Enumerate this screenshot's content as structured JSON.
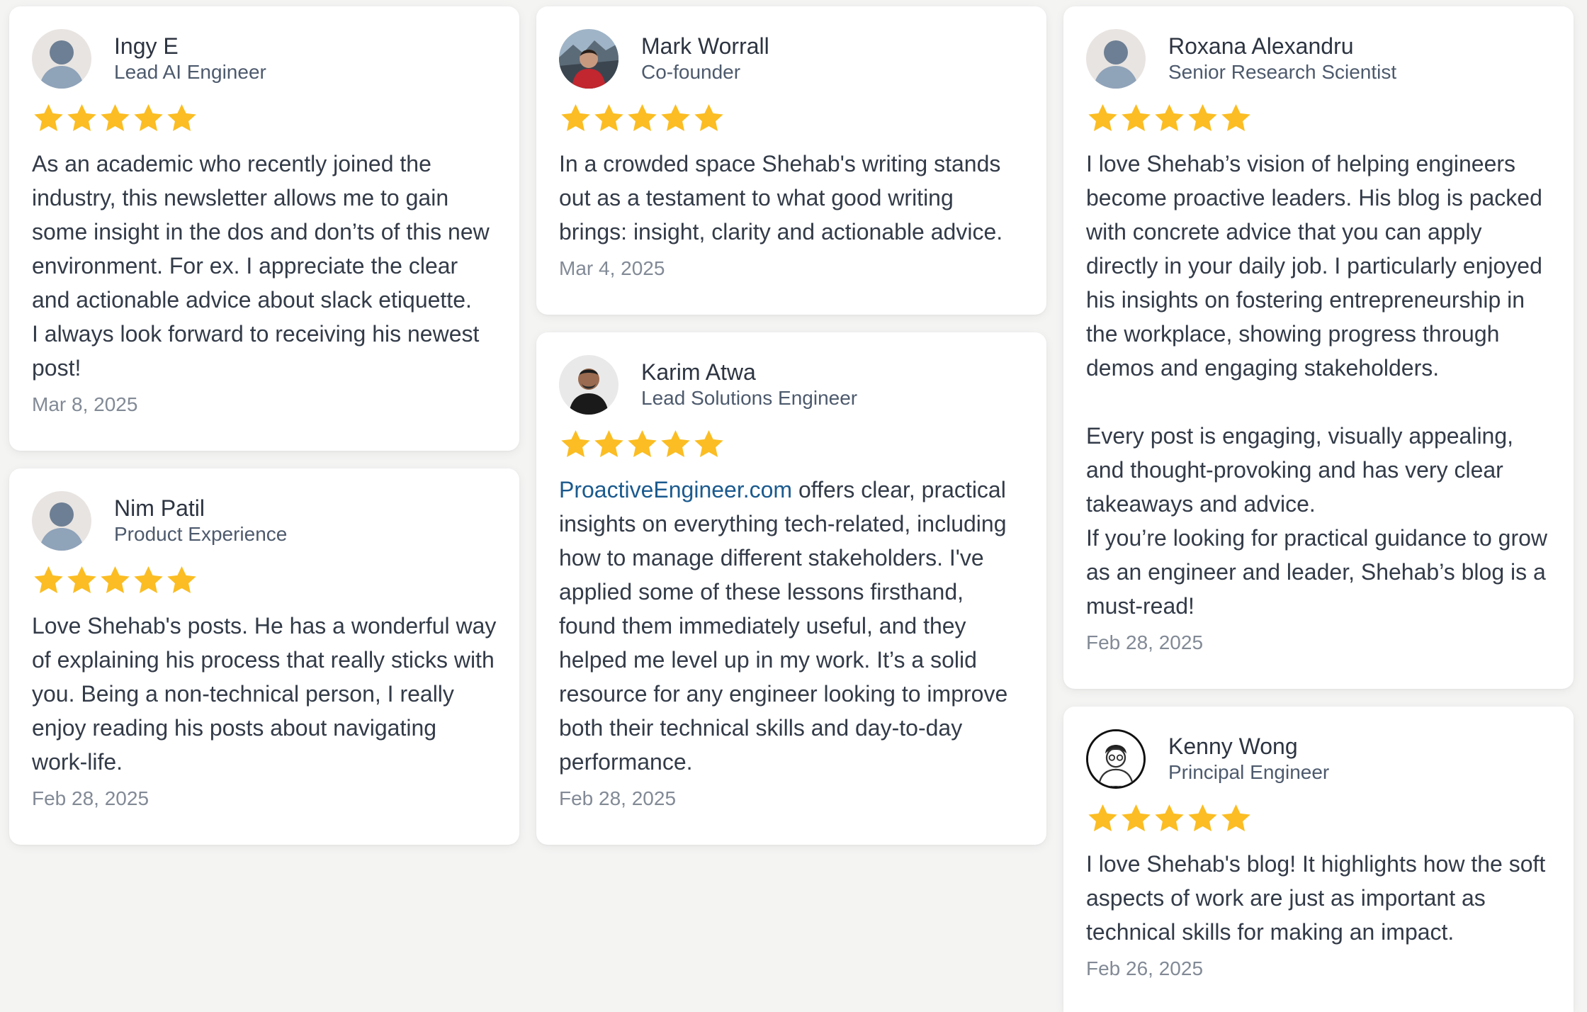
{
  "colors": {
    "star": "#FBBD23",
    "link": "#1B5A8E",
    "background": "#F4F4F3"
  },
  "rating_max": 5,
  "testimonials": [
    {
      "name": "Ingy E",
      "role": "Lead AI Engineer",
      "avatar": "default-avatar-icon",
      "rating": 5,
      "review": "As an academic who recently joined the industry, this newsletter allows me to gain some insight in the dos and don’ts of this new environment. For ex. I appreciate the clear and actionable advice about slack etiquette.\nI always look forward to receiving his newest post!",
      "date": "Mar 8, 2025"
    },
    {
      "name": "Nim Patil",
      "role": "Product Experience",
      "avatar": "default-avatar-icon",
      "rating": 5,
      "review": "Love Shehab's posts. He has a wonderful way of explaining his process that really sticks with you. Being a non-technical person, I really enjoy reading his posts about navigating work-life.",
      "date": "Feb 28, 2025"
    },
    {
      "name": "Mark Worrall",
      "role": "Co-founder",
      "avatar": "profile-photo",
      "rating": 5,
      "review": "In a crowded space Shehab's writing stands out as a testament to what good writing brings: insight, clarity and actionable advice.",
      "date": "Mar 4, 2025"
    },
    {
      "name": "Karim Atwa",
      "role": "Lead Solutions Engineer",
      "avatar": "profile-photo",
      "rating": 5,
      "review_link": "ProactiveEngineer.com",
      "review": " offers clear, practical insights on everything tech-related, including how to manage different stakeholders. I've applied some of these lessons firsthand, found them immediately useful, and they helped me level up in my work. It’s a solid resource for any engineer looking to improve both their technical skills and day-to-day performance.",
      "date": "Feb 28, 2025"
    },
    {
      "name": "Roxana Alexandru",
      "role": "Senior Research Scientist",
      "avatar": "default-avatar-icon",
      "rating": 5,
      "review": "I love Shehab’s vision of helping engineers become proactive leaders. His blog is packed with concrete advice that you can apply directly in your daily job. I particularly enjoyed his insights on fostering entrepreneurship in the workplace, showing progress through demos and engaging stakeholders.\n\nEvery post is engaging, visually appealing, and thought-provoking and has very clear takeaways and advice.\nIf you’re looking for practical guidance to grow as an engineer and leader, Shehab’s blog is a must-read!",
      "date": "Feb 28, 2025"
    },
    {
      "name": "Kenny Wong",
      "role": "Principal Engineer",
      "avatar": "profile-photo",
      "rating": 5,
      "review": "I love Shehab's blog! It highlights how the soft aspects of work are just as important as technical skills for making an impact.",
      "date": "Feb 26, 2025"
    }
  ]
}
